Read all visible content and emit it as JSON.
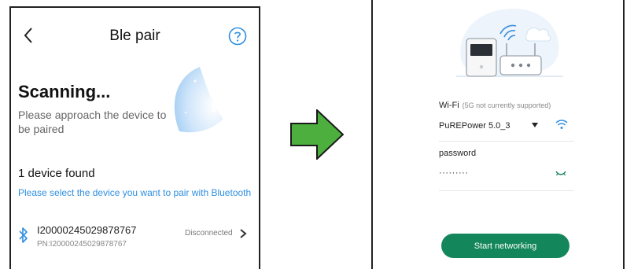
{
  "left_screen": {
    "title": "Ble pair",
    "scanning_title": "Scanning...",
    "scanning_subtitle": "Please approach the device to be paired",
    "found_count": "1 device found",
    "hint": "Please select the device you want to pair with Bluetooth",
    "device": {
      "id": "I20000245029878767",
      "pn": "PN:I20000245029878767",
      "status": "Disconnected"
    },
    "icons": [
      "back-icon",
      "help-icon",
      "radar-graphic",
      "bluetooth-icon",
      "chevron-right-icon"
    ],
    "colors": {
      "link_blue": "#2f8fe0",
      "radar_blue": "#a9d2f5"
    }
  },
  "arrow": {
    "color": "#4caf3e",
    "outline": "#1a1a1a",
    "direction": "right"
  },
  "right_screen": {
    "wifi_label": "Wi-Fi",
    "wifi_note": "(5G not currently supported)",
    "ssid": "PuREPower 5.0_3",
    "password_label": "password",
    "password_value": "·········",
    "start_button": "Start networking",
    "icons": [
      "device-router-illustration",
      "dropdown-icon",
      "wifi-icon",
      "eye-closed-icon"
    ],
    "colors": {
      "primary_green": "#13865b",
      "wifi_blue": "#2f8fe0"
    }
  }
}
